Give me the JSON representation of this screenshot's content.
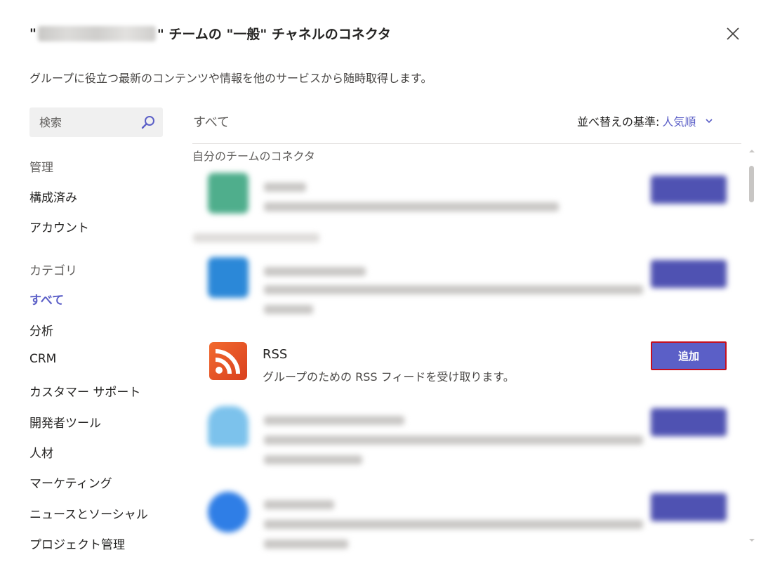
{
  "dialog": {
    "title_prefix": "\"",
    "title_suffix": "\" チームの \"一般\" チャネルのコネクタ",
    "subtitle": "グループに役立つ最新のコンテンツや情報を他のサービスから随時取得します。"
  },
  "sidebar": {
    "search_placeholder": "検索",
    "manage_heading": "管理",
    "manage_items": [
      "構成済み",
      "アカウント"
    ],
    "category_heading": "カテゴリ",
    "category_items": [
      "すべて",
      "分析",
      "CRM",
      "カスタマー サポート",
      "開発者ツール",
      "人材",
      "マーケティング",
      "ニュースとソーシャル",
      "プロジェクト管理"
    ],
    "active_category": "すべて"
  },
  "main": {
    "heading": "すべて",
    "sort_label": "並べ替えの基準:",
    "sort_value": "人気順",
    "section_label": "自分のチームのコネクタ",
    "rss": {
      "name": "RSS",
      "description": "グループのための RSS フィードを受け取ります。",
      "add_label": "追加"
    }
  },
  "colors": {
    "accent": "#5b5fc7",
    "highlight_border": "#c50f1f",
    "rss_orange": "#e8552a"
  }
}
